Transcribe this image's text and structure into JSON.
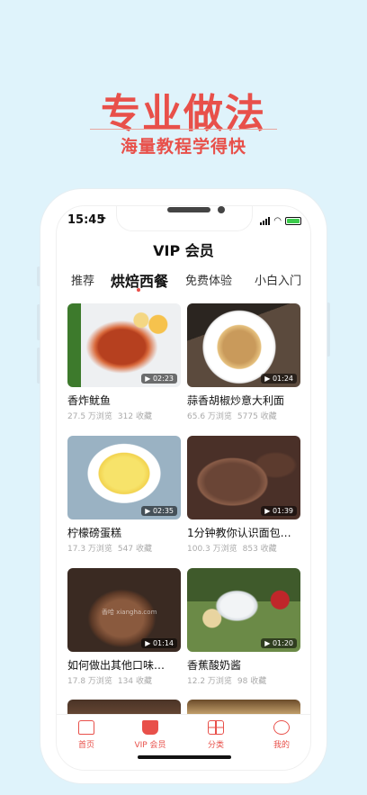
{
  "promo": {
    "title": "专业做法",
    "subtitle": "海量教程学得快"
  },
  "status": {
    "time": "15:45"
  },
  "header": {
    "title": "VIP 会员"
  },
  "tabs": [
    {
      "label": "推荐"
    },
    {
      "label": "烘焙西餐",
      "active": true
    },
    {
      "label": "免费体验"
    },
    {
      "label": "小白入门"
    }
  ],
  "cards": [
    {
      "title": "香炸鱿鱼",
      "views": "27.5 万浏览",
      "favorites": "312 收藏",
      "duration": "02:23"
    },
    {
      "title": "蒜香胡椒炒意大利面",
      "views": "65.6 万浏览",
      "favorites": "5775 收藏",
      "duration": "01:24"
    },
    {
      "title": "柠檬磅蛋糕",
      "views": "17.3 万浏览",
      "favorites": "547 收藏",
      "duration": "02:35"
    },
    {
      "title": "1分钟教你认识面包…",
      "views": "100.3 万浏览",
      "favorites": "853 收藏",
      "duration": "01:39"
    },
    {
      "title": "如何做出其他口味…",
      "views": "17.8 万浏览",
      "favorites": "134 收藏",
      "duration": "01:14",
      "watermark": "香哈 xiangha.com"
    },
    {
      "title": "香蕉酸奶酱",
      "views": "12.2 万浏览",
      "favorites": "98 收藏",
      "duration": "01:20"
    }
  ],
  "tabbar": [
    {
      "label": "首页",
      "icon": "home-icon"
    },
    {
      "label": "VIP 会员",
      "icon": "vip-crown-icon"
    },
    {
      "label": "分类",
      "icon": "category-grid-icon"
    },
    {
      "label": "我的",
      "icon": "profile-icon"
    }
  ],
  "colors": {
    "accent": "#e8504a",
    "background": "#dff3fb"
  }
}
